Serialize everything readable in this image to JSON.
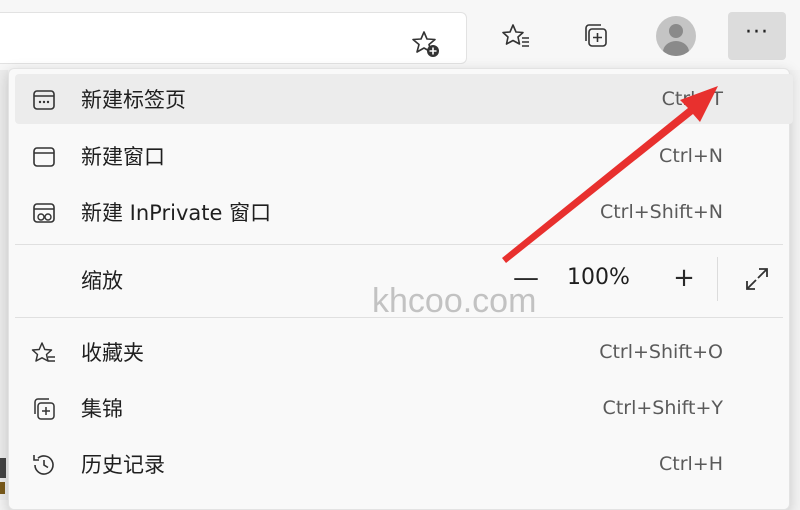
{
  "toolbar": {
    "add_favorite_icon": "star-plus-icon",
    "favorites_icon": "favorites-list-icon",
    "collections_icon": "collections-icon",
    "profile_icon": "avatar",
    "more_label": "···"
  },
  "menu": {
    "items": [
      {
        "icon": "new-tab-icon",
        "label": "新建标签页",
        "shortcut": "Ctrl+T"
      },
      {
        "icon": "new-window-icon",
        "label": "新建窗口",
        "shortcut": "Ctrl+N"
      },
      {
        "icon": "inprivate-icon",
        "label": "新建 InPrivate 窗口",
        "shortcut": "Ctrl+Shift+N"
      },
      {
        "icon": "favorites-icon",
        "label": "收藏夹",
        "shortcut": "Ctrl+Shift+O"
      },
      {
        "icon": "collections-icon",
        "label": "集锦",
        "shortcut": "Ctrl+Shift+Y"
      },
      {
        "icon": "history-icon",
        "label": "历史记录",
        "shortcut": "Ctrl+H"
      }
    ],
    "zoom": {
      "label": "缩放",
      "minus": "—",
      "value": "100%",
      "plus": "+"
    }
  },
  "watermark": "khcoo.com",
  "colors": {
    "arrow": "#e8302e",
    "hover": "#ececec"
  }
}
